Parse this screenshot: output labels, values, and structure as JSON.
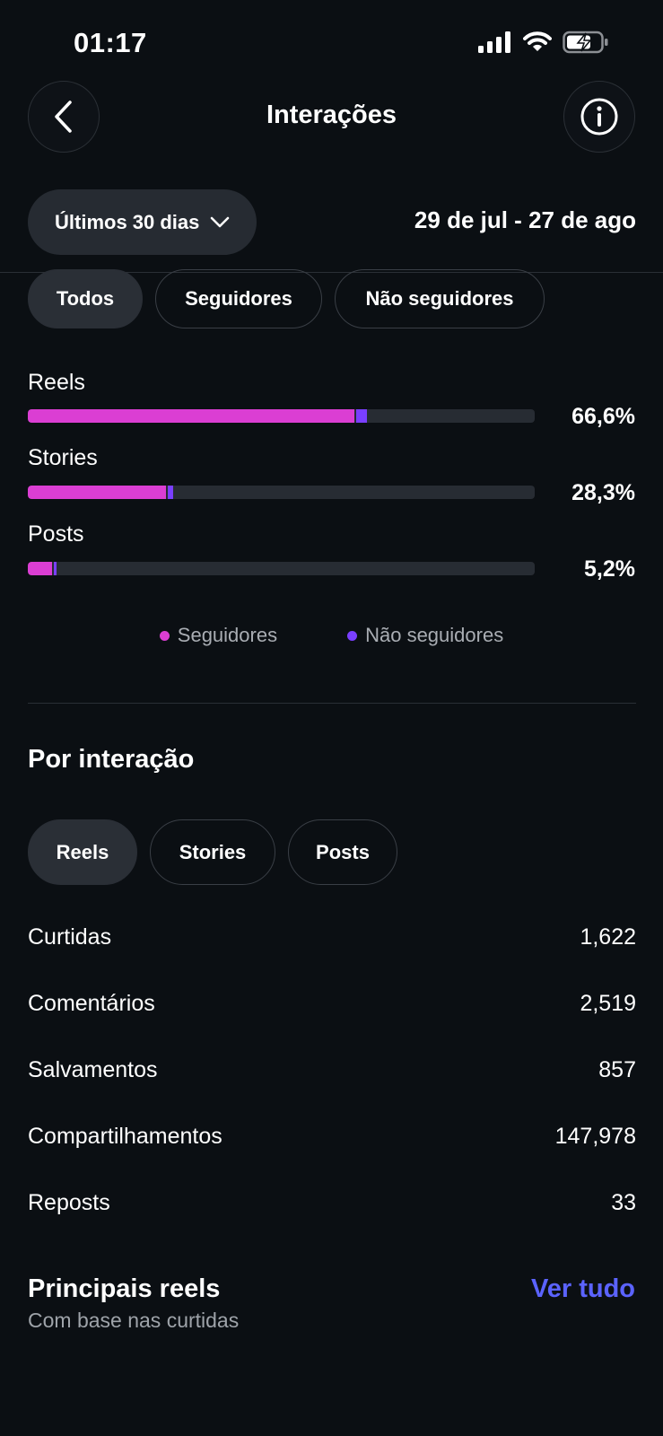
{
  "status": {
    "time": "01:17"
  },
  "header": {
    "title": "Interações"
  },
  "period": {
    "label": "Últimos 30 dias",
    "range": "29 de jul - 27 de ago"
  },
  "audience_filters": [
    {
      "label": "Todos",
      "active": true
    },
    {
      "label": "Seguidores",
      "active": false
    },
    {
      "label": "Não seguidores",
      "active": false
    }
  ],
  "breakdown": [
    {
      "label": "Reels",
      "percent": "66,6%",
      "followers_fraction": 0.645,
      "non_followers_fraction": 0.021
    },
    {
      "label": "Stories",
      "percent": "28,3%",
      "followers_fraction": 0.272,
      "non_followers_fraction": 0.011
    },
    {
      "label": "Posts",
      "percent": "5,2%",
      "followers_fraction": 0.047,
      "non_followers_fraction": 0.005
    }
  ],
  "legend": {
    "followers": "Seguidores",
    "non_followers": "Não seguidores"
  },
  "colors": {
    "followers": "#db3ed3",
    "non_followers": "#7a3fff",
    "link": "#5b63ff"
  },
  "by_interaction": {
    "title": "Por interação",
    "tabs": [
      {
        "label": "Reels",
        "active": true
      },
      {
        "label": "Stories",
        "active": false
      },
      {
        "label": "Posts",
        "active": false
      }
    ],
    "metrics": [
      {
        "label": "Curtidas",
        "value": "1,622"
      },
      {
        "label": "Comentários",
        "value": "2,519"
      },
      {
        "label": "Salvamentos",
        "value": "857"
      },
      {
        "label": "Compartilhamentos",
        "value": "147,978"
      },
      {
        "label": "Reposts",
        "value": "33"
      }
    ]
  },
  "top_reels": {
    "title": "Principais reels",
    "subtitle": "Com base nas curtidas",
    "see_all": "Ver tudo"
  }
}
